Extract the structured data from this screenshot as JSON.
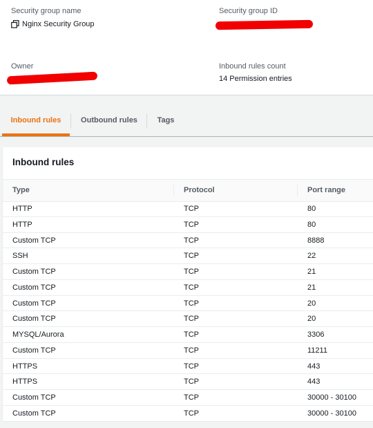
{
  "summary": {
    "security_group_name_label": "Security group name",
    "security_group_name": "Nginx Security Group",
    "security_group_id_label": "Security group ID",
    "owner_label": "Owner",
    "inbound_rules_count_label": "Inbound rules count",
    "inbound_rules_count": "14 Permission entries",
    "redaction_color": "#f20000"
  },
  "tabs": [
    {
      "label": "Inbound rules",
      "active": true
    },
    {
      "label": "Outbound rules",
      "active": false
    },
    {
      "label": "Tags",
      "active": false
    }
  ],
  "accent_color": "#ec7211",
  "inbound": {
    "title": "Inbound rules",
    "columns": [
      "Type",
      "Protocol",
      "Port range"
    ],
    "rows": [
      {
        "type": "HTTP",
        "protocol": "TCP",
        "port_range": "80"
      },
      {
        "type": "HTTP",
        "protocol": "TCP",
        "port_range": "80"
      },
      {
        "type": "Custom TCP",
        "protocol": "TCP",
        "port_range": "8888"
      },
      {
        "type": "SSH",
        "protocol": "TCP",
        "port_range": "22"
      },
      {
        "type": "Custom TCP",
        "protocol": "TCP",
        "port_range": "21"
      },
      {
        "type": "Custom TCP",
        "protocol": "TCP",
        "port_range": "21"
      },
      {
        "type": "Custom TCP",
        "protocol": "TCP",
        "port_range": "20"
      },
      {
        "type": "Custom TCP",
        "protocol": "TCP",
        "port_range": "20"
      },
      {
        "type": "MYSQL/Aurora",
        "protocol": "TCP",
        "port_range": "3306"
      },
      {
        "type": "Custom TCP",
        "protocol": "TCP",
        "port_range": "11211"
      },
      {
        "type": "HTTPS",
        "protocol": "TCP",
        "port_range": "443"
      },
      {
        "type": "HTTPS",
        "protocol": "TCP",
        "port_range": "443"
      },
      {
        "type": "Custom TCP",
        "protocol": "TCP",
        "port_range": "30000 - 30100"
      },
      {
        "type": "Custom TCP",
        "protocol": "TCP",
        "port_range": "30000 - 30100"
      }
    ]
  }
}
